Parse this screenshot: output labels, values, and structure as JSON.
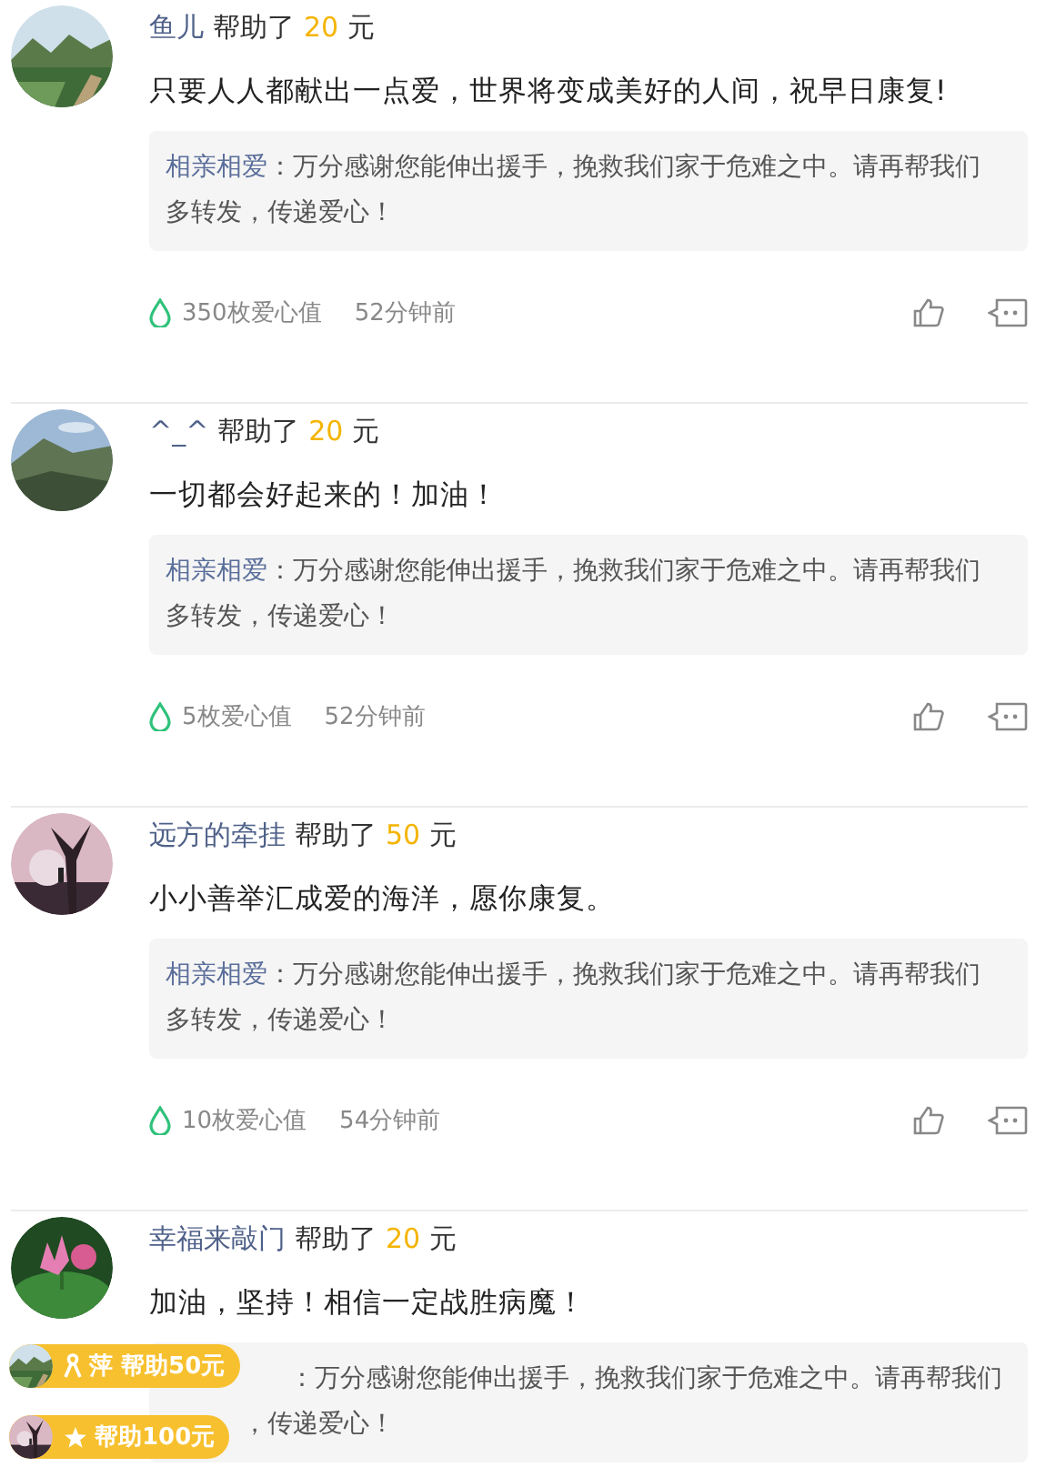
{
  "comments": [
    {
      "name": "鱼儿",
      "helped": "帮助了",
      "amount": "20",
      "unit": "元",
      "text": "只要人人都献出一点爱，世界将变成美好的人间，祝早日康复!",
      "reply": {
        "author": "相亲相爱",
        "lines": [
          "：万分感谢您能伸出援手，挽救我们家于危难之中。请再帮我们",
          "多转发，传递爱心！"
        ]
      },
      "footer": {
        "points": "350枚爱心值",
        "time": "52分钟前"
      }
    },
    {
      "name": "^_^",
      "helped": "帮助了",
      "amount": "20",
      "unit": "元",
      "text": "一切都会好起来的！加油！",
      "reply": {
        "author": "相亲相爱",
        "lines": [
          "：万分感谢您能伸出援手，挽救我们家于危难之中。请再帮我们",
          "多转发，传递爱心！"
        ]
      },
      "footer": {
        "points": "5枚爱心值",
        "time": "52分钟前"
      }
    },
    {
      "name": "远方的牵挂",
      "helped": "帮助了",
      "amount": "50",
      "unit": "元",
      "text": "小小善举汇成爱的海洋，愿你康复。",
      "reply": {
        "author": "相亲相爱",
        "lines": [
          "：万分感谢您能伸出援手，挽救我们家于危难之中。请再帮我们",
          "多转发，传递爱心！"
        ]
      },
      "footer": {
        "points": "10枚爱心值",
        "time": "54分钟前"
      }
    },
    {
      "name": "幸福来敲门",
      "helped": "帮助了",
      "amount": "20",
      "unit": "元",
      "text": "加油，坚持！相信一定战胜病魔！",
      "reply": {
        "lines": [
          "：万分感谢您能伸出援手，挽救我们家于危难之中。请再帮我们",
          "，传递爱心！"
        ]
      }
    }
  ],
  "toasts": [
    {
      "text": "萍 帮助50元"
    },
    {
      "text": "帮助100元"
    }
  ]
}
